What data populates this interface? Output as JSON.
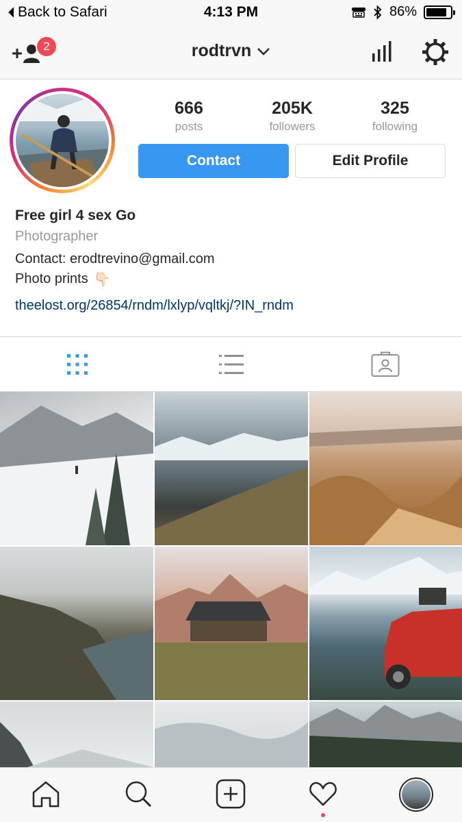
{
  "status_bar": {
    "back_label": "Back to Safari",
    "time": "4:13 PM",
    "battery_text": "86%",
    "battery_level": 0.86
  },
  "nav": {
    "username": "rodtrvn",
    "notification_count": "2"
  },
  "stats": {
    "posts_value": "666",
    "posts_label": "posts",
    "followers_value": "205K",
    "followers_label": "followers",
    "following_value": "325",
    "following_label": "following"
  },
  "buttons": {
    "contact": "Contact",
    "edit_profile": "Edit Profile"
  },
  "bio": {
    "name": "Free girl 4 sex Go",
    "category": "Photographer",
    "contact_line": "Contact: erodtrevino@gmail.com",
    "prints_line": "Photo prints",
    "prints_emoji": "👇🏻",
    "link": "theelost.org/26854/rndm/lxlyp/vqltkj/?IN_rndm"
  },
  "tabs": [
    {
      "icon": "grid-icon",
      "active": true
    },
    {
      "icon": "list-icon",
      "active": false
    },
    {
      "icon": "tagged-icon",
      "active": false
    }
  ],
  "grid_photos": [
    {
      "subject": "snowy mountain trail"
    },
    {
      "subject": "mountain ridge at sunrise"
    },
    {
      "subject": "desert badlands"
    },
    {
      "subject": "foggy coastline"
    },
    {
      "subject": "log cabin with mountains"
    },
    {
      "subject": "red jeep by lake"
    },
    {
      "subject": "snowy peak"
    },
    {
      "subject": "frosted forest hills"
    },
    {
      "subject": "alpine valley"
    }
  ],
  "bottom_bar": [
    "home-icon",
    "search-icon",
    "new-post-icon",
    "activity-icon",
    "profile-avatar"
  ],
  "colors": {
    "accent": "#3897f0",
    "badge": "#ed4956",
    "link": "#003569",
    "muted": "#999999"
  }
}
